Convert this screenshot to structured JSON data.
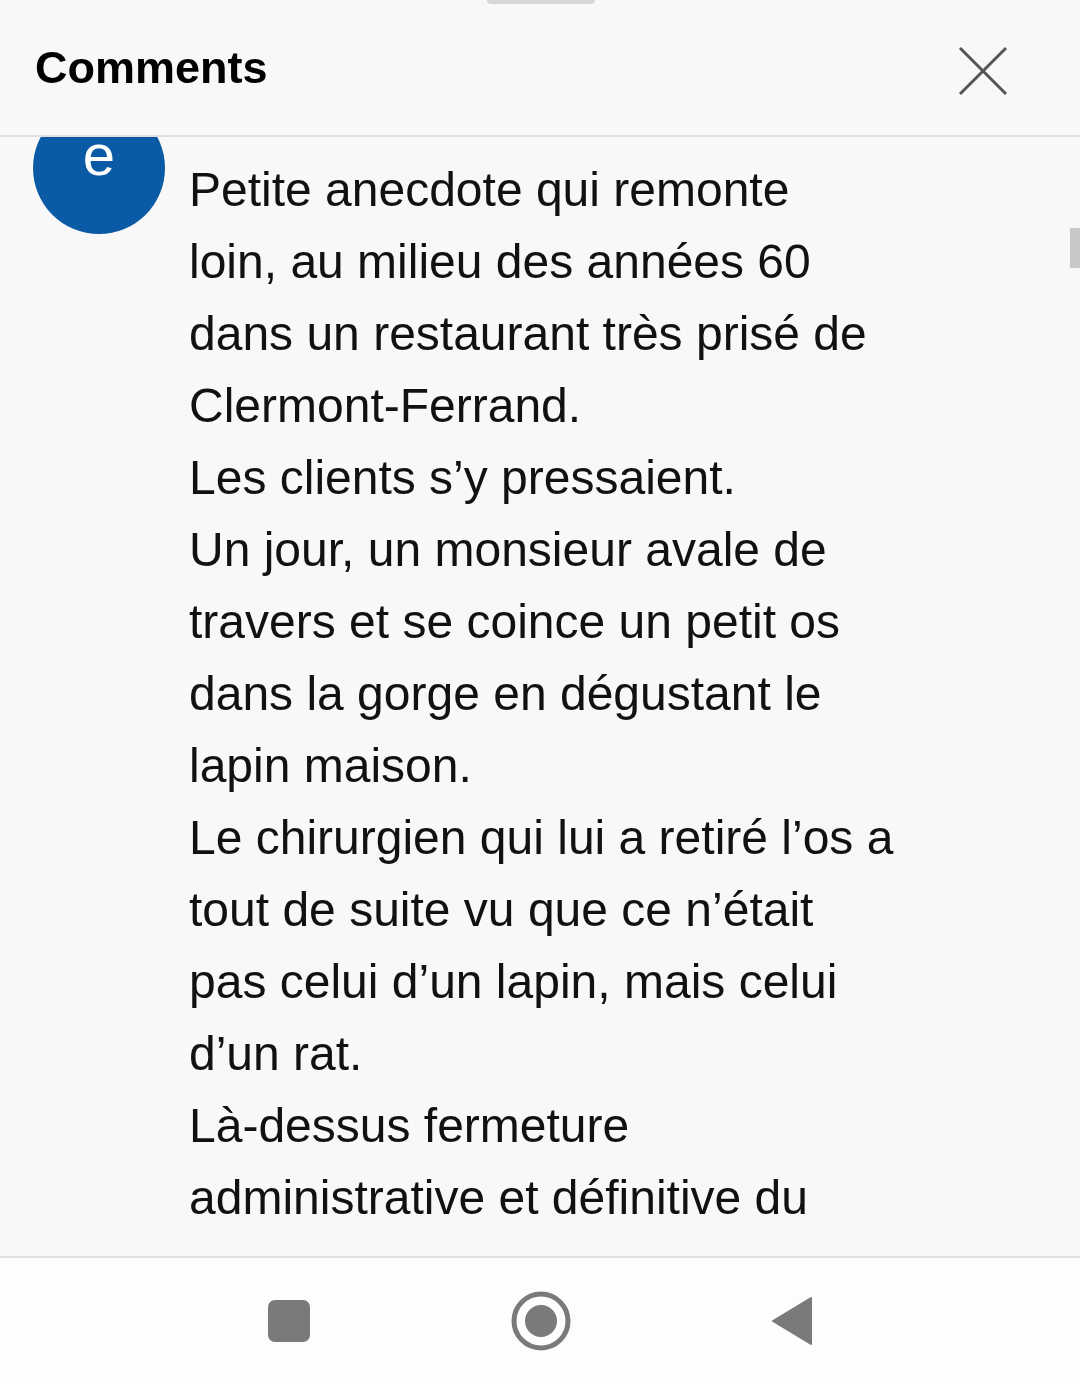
{
  "header": {
    "title": "Comments"
  },
  "comment": {
    "avatar_letter": "e",
    "lines": [
      "Petite anecdote qui remonte",
      "loin, au milieu des années 60",
      "dans un restaurant très prisé de",
      "Clermont-Ferrand.",
      "Les clients s’y pressaient.",
      "Un jour, un monsieur avale de",
      "travers et se coince un petit os",
      "dans la gorge en dégustant le",
      "lapin maison.",
      "Le chirurgien qui lui a retiré l’os a",
      "tout de suite vu que ce n’était",
      "pas celui d’un lapin, mais celui",
      "d’un rat.",
      "Là-dessus fermeture",
      "administrative et définitive du"
    ]
  }
}
